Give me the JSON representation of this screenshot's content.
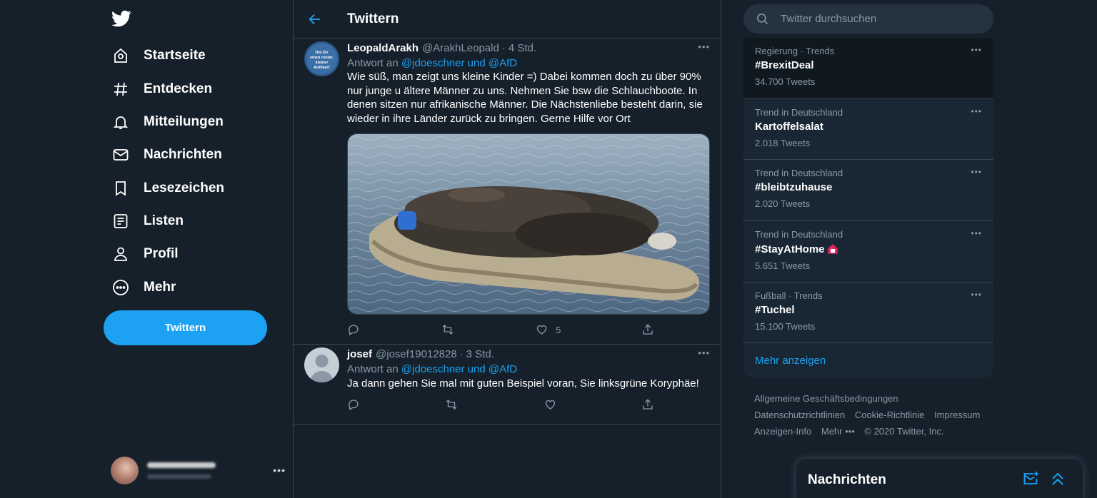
{
  "nav": {
    "items": [
      {
        "label": "Startseite",
        "icon": "home-icon"
      },
      {
        "label": "Entdecken",
        "icon": "hashtag-icon"
      },
      {
        "label": "Mitteilungen",
        "icon": "bell-icon"
      },
      {
        "label": "Nachrichten",
        "icon": "mail-icon"
      },
      {
        "label": "Lesezeichen",
        "icon": "bookmark-icon"
      },
      {
        "label": "Listen",
        "icon": "list-icon"
      },
      {
        "label": "Profil",
        "icon": "person-icon"
      },
      {
        "label": "Mehr",
        "icon": "more-circle-icon"
      }
    ],
    "tweet_button": "Twittern",
    "account_more": "•••"
  },
  "main": {
    "title": "Twittern",
    "tweets": [
      {
        "name": "LeopaldArakh",
        "handle": "@ArakhLeopald",
        "time": "4 Std.",
        "reply_prefix": "Antwort an",
        "reply_mention_1": "@jdoeschner",
        "reply_and": "und",
        "reply_mention_2": "@AfD",
        "text": "Wie süß, man zeigt uns kleine Kinder =) Dabei kommen doch zu über  90% nur junge u ältere Männer zu uns. Nehmen Sie bsw die Schlauchboote. In denen sitzen nur afrikanische Männer. Die Nächstenliebe besteht darin, sie wieder in ihre Länder zurück zu bringen. Gerne Hilfe vor Ort",
        "avatar_text": "Hol Dir einen runter, kleiner Antifant!",
        "likes": "5"
      },
      {
        "name": "josef",
        "handle": "@josef19012828",
        "time": "3 Std.",
        "reply_prefix": "Antwort an",
        "reply_mention_1": "@jdoeschner",
        "reply_and": "und",
        "reply_mention_2": "@AfD",
        "text": "Ja dann gehen Sie mal mit guten Beispiel voran, Sie linksgrüne Koryphäe!"
      }
    ]
  },
  "search": {
    "placeholder": "Twitter durchsuchen"
  },
  "trends": [
    {
      "category": "Regierung · Trends",
      "name": "#BrexitDeal",
      "count": "34.700 Tweets"
    },
    {
      "category": "Trend in Deutschland",
      "name": "Kartoffelsalat",
      "count": "2.018 Tweets"
    },
    {
      "category": "Trend in Deutschland",
      "name": "#bleibtzuhause",
      "count": "2.020 Tweets"
    },
    {
      "category": "Trend in Deutschland",
      "name": "#StayAtHome",
      "count": "5.651 Tweets"
    },
    {
      "category": "Fußball · Trends",
      "name": "#Tuchel",
      "count": "15.100 Tweets"
    }
  ],
  "show_more": "Mehr anzeigen",
  "footer": {
    "terms": "Allgemeine Geschäftsbedingungen",
    "privacy": "Datenschutzrichtlinien",
    "cookies": "Cookie-Richtlinie",
    "imprint": "Impressum",
    "ads": "Anzeigen-Info",
    "more": "Mehr •••",
    "copyright": "© 2020 Twitter, Inc."
  },
  "dock": {
    "title": "Nachrichten"
  },
  "colors": {
    "accent": "#1da1f2",
    "background": "#15202b",
    "panel": "#192734",
    "muted": "#8899a6",
    "border": "#38444d"
  }
}
